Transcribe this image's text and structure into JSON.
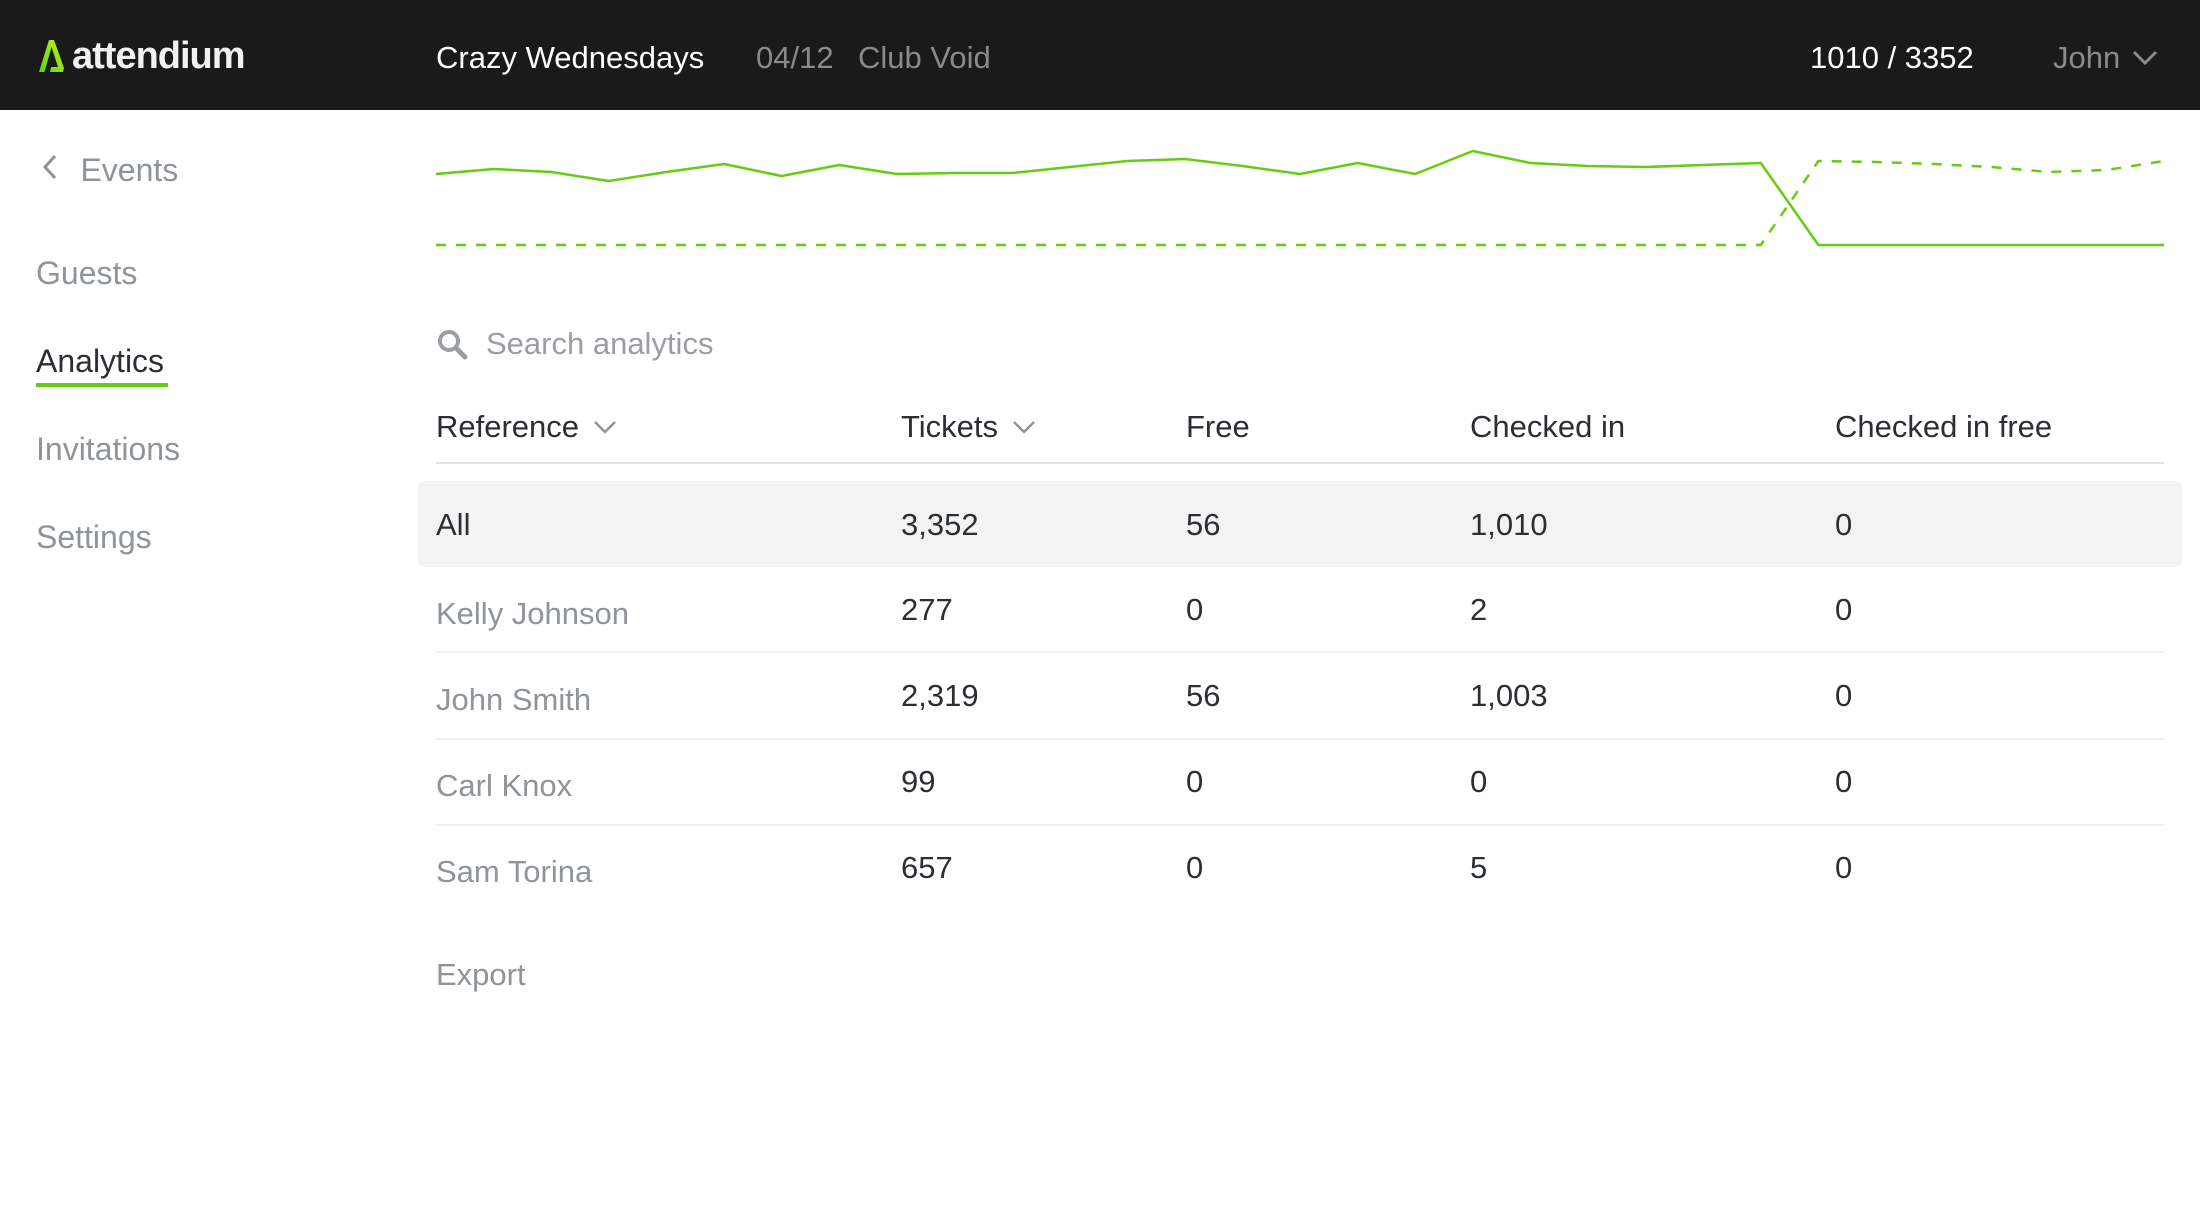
{
  "header": {
    "brand": "attendium",
    "event_title": "Crazy Wednesdays",
    "event_date": "04/12",
    "event_venue": "Club Void",
    "checkin_count": "1010 / 3352",
    "user_name": "John",
    "accent_color": "#66cc11"
  },
  "sidebar": {
    "back_label": "Events",
    "items": [
      {
        "label": "Guests",
        "active": false
      },
      {
        "label": "Analytics",
        "active": true
      },
      {
        "label": "Invitations",
        "active": false
      },
      {
        "label": "Settings",
        "active": false
      }
    ]
  },
  "search": {
    "placeholder": "Search analytics",
    "value": ""
  },
  "table": {
    "columns": [
      {
        "label": "Reference",
        "sortable": true
      },
      {
        "label": "Tickets",
        "sortable": true
      },
      {
        "label": "Free",
        "sortable": false
      },
      {
        "label": "Checked in",
        "sortable": false
      },
      {
        "label": "Checked in free",
        "sortable": false
      }
    ],
    "rows": [
      {
        "reference": "All",
        "tickets": "3,352",
        "free": "56",
        "checked_in": "1,010",
        "checked_in_free": "0",
        "highlighted": true
      },
      {
        "reference": "Kelly Johnson",
        "tickets": "277",
        "free": "0",
        "checked_in": "2",
        "checked_in_free": "0"
      },
      {
        "reference": "John Smith",
        "tickets": "2,319",
        "free": "56",
        "checked_in": "1,003",
        "checked_in_free": "0"
      },
      {
        "reference": "Carl Knox",
        "tickets": "99",
        "free": "0",
        "checked_in": "0",
        "checked_in_free": "0"
      },
      {
        "reference": "Sam Torina",
        "tickets": "657",
        "free": "0",
        "checked_in": "5",
        "checked_in_free": "0"
      }
    ]
  },
  "export_label": "Export",
  "chart_data": {
    "type": "line",
    "title": "",
    "xlabel": "",
    "ylabel": "",
    "grid": false,
    "legend": "none",
    "ylim": [
      0,
      100
    ],
    "series": [
      {
        "name": "solid",
        "style": "solid",
        "values": [
          71,
          76,
          73,
          64,
          73,
          81,
          69,
          80,
          71,
          72,
          72,
          78,
          84,
          86,
          79,
          71,
          82,
          71,
          94,
          82,
          79,
          78,
          80,
          82,
          0,
          0,
          0,
          0,
          0,
          0,
          0
        ]
      },
      {
        "name": "dashed",
        "style": "dashed",
        "values": [
          0,
          0,
          0,
          0,
          0,
          0,
          0,
          0,
          0,
          0,
          0,
          0,
          0,
          0,
          0,
          0,
          0,
          0,
          0,
          0,
          0,
          0,
          0,
          0,
          84,
          83,
          81,
          78,
          73,
          75,
          84
        ]
      }
    ]
  }
}
